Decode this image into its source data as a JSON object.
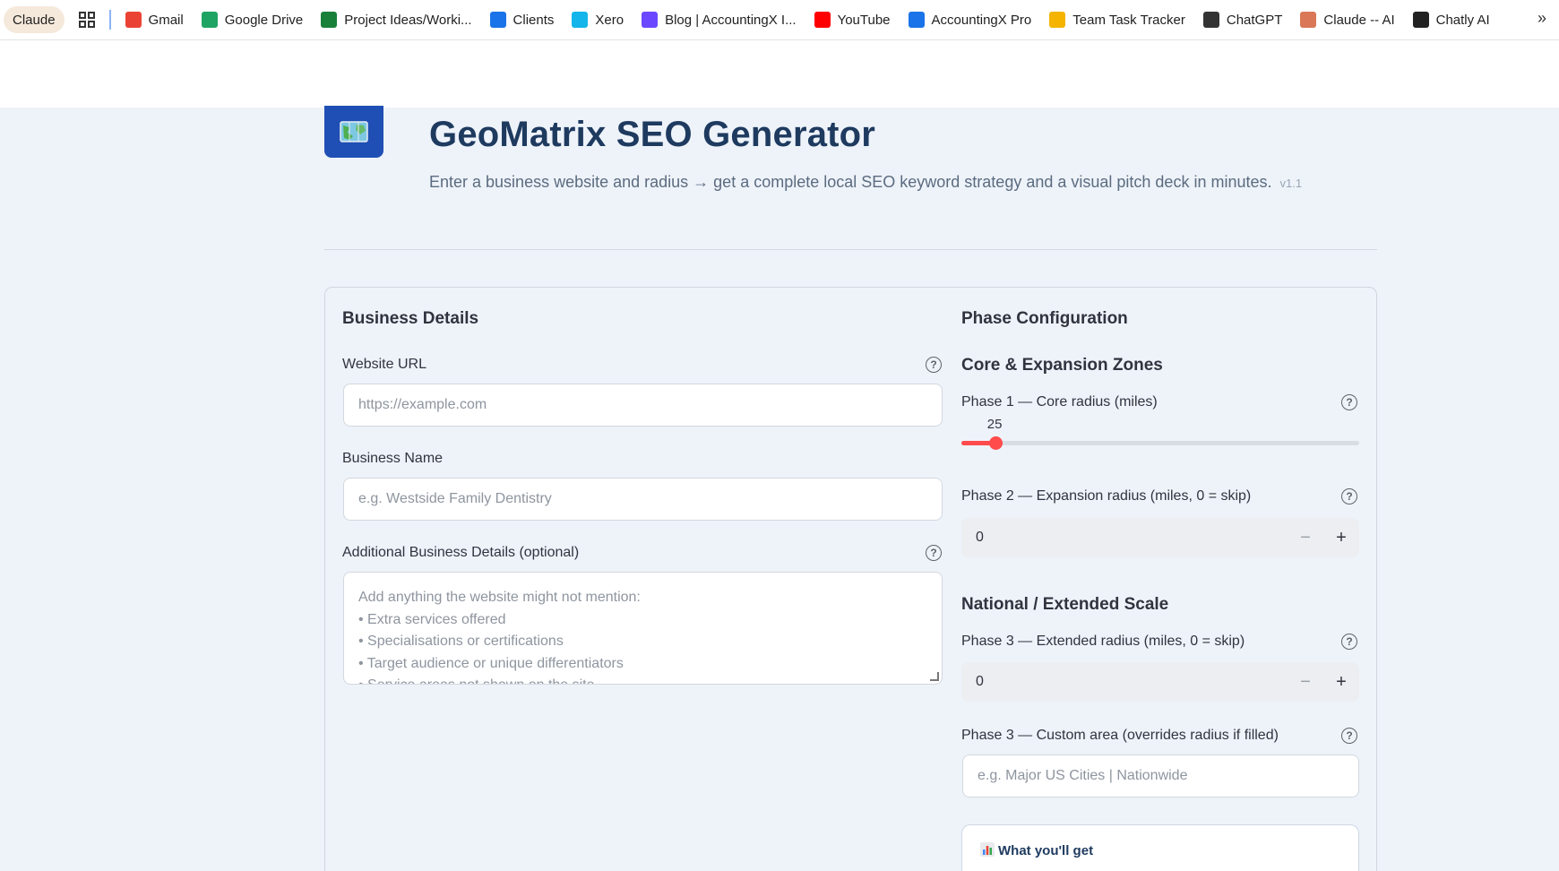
{
  "bookmarks": [
    {
      "label": "Gmail",
      "icon": "gmail-icon",
      "color": "#ea4335"
    },
    {
      "label": "Google Drive",
      "icon": "google-drive-icon",
      "color": "#1fa463"
    },
    {
      "label": "Project Ideas/Worki...",
      "icon": "sheet-icon",
      "color": "#188038"
    },
    {
      "label": "Clients",
      "icon": "clients-icon",
      "color": "#1a73e8"
    },
    {
      "label": "Xero",
      "icon": "xero-icon",
      "color": "#13b5ea"
    },
    {
      "label": "Blog | AccountingX I...",
      "icon": "blog-icon",
      "color": "#6b48ff"
    },
    {
      "label": "YouTube",
      "icon": "youtube-icon",
      "color": "#ff0000"
    },
    {
      "label": "AccountingX Pro",
      "icon": "accountingx-icon",
      "color": "#1a73e8"
    },
    {
      "label": "Team Task Tracker",
      "icon": "chart-icon",
      "color": "#f4b400"
    },
    {
      "label": "ChatGPT",
      "icon": "chatgpt-icon",
      "color": "#333333"
    },
    {
      "label": "Claude -- AI",
      "icon": "claude-icon",
      "color": "#d97757"
    },
    {
      "label": "Chatly AI",
      "icon": "chatly-icon",
      "color": "#222222"
    }
  ],
  "tab_group": {
    "label": "Claude"
  },
  "header": {
    "title": "GeoMatrix SEO Generator",
    "subtitle": "Enter a business website and radius → get a complete local SEO keyword strategy and a visual pitch deck in minutes.",
    "version": "v1.1"
  },
  "business": {
    "heading": "Business Details",
    "website_label": "Website URL",
    "website_placeholder": "https://example.com",
    "name_label": "Business Name",
    "name_placeholder": "e.g. Westside Family Dentistry",
    "details_label": "Additional Business Details (optional)",
    "details_placeholder_lines": [
      "Add anything the website might not mention:",
      "• Extra services offered",
      "• Specialisations or certifications",
      "• Target audience or unique differentiators",
      "• Service areas not shown on the site"
    ]
  },
  "phase": {
    "heading": "Phase Configuration",
    "core_heading": "Core & Expansion Zones",
    "p1_label": "Phase 1 — Core radius (miles)",
    "p1_value": 25,
    "p1_value_text": "25",
    "p1_fraction": 0.085,
    "p2_label": "Phase 2 — Expansion radius (miles, 0 = skip)",
    "p2_value": "0",
    "national_heading": "National / Extended Scale",
    "p3_label": "Phase 3 — Extended radius (miles, 0 = skip)",
    "p3_value": "0",
    "p3_custom_label": "Phase 3 — Custom area (overrides radius if filled)",
    "p3_custom_placeholder": "e.g. Major US Cities | Nationwide"
  },
  "info": {
    "title": "What you'll get",
    "icon": "bar-chart-icon"
  },
  "colors": {
    "accent": "#ff4b4b",
    "brand": "#1f4fb4",
    "title": "#1e3a5f"
  }
}
